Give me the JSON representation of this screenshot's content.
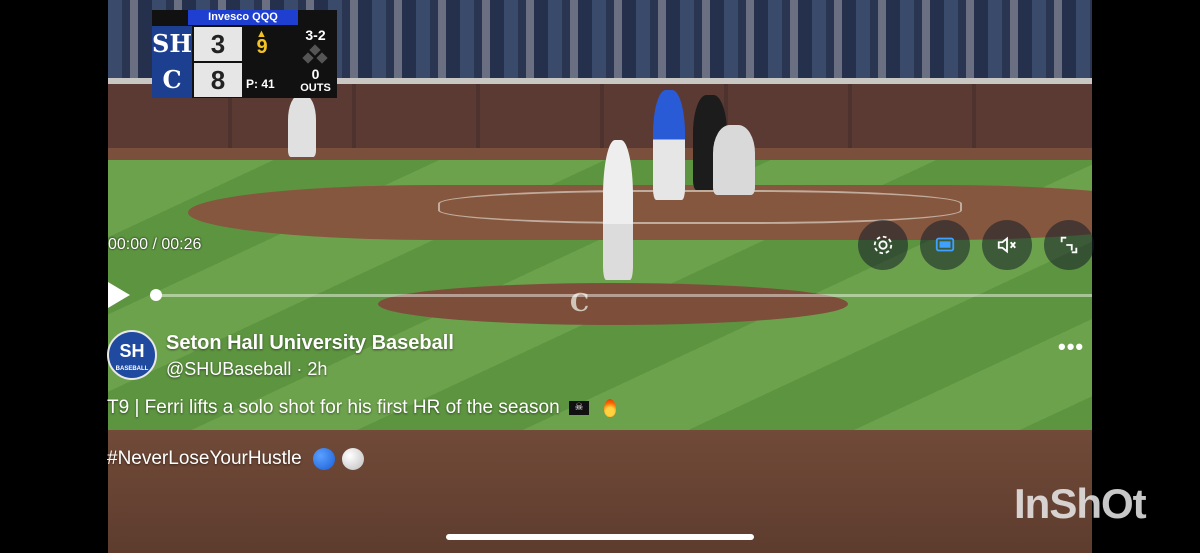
{
  "scorebug": {
    "sponsor": "Invesco QQQ",
    "team1_logo": "SH",
    "team2_logo": "C",
    "team1_score": "3",
    "team2_score": "8",
    "inning_arrow": "▲",
    "inning": "9",
    "pitch_count": "P: 41",
    "count": "3-2",
    "outs_value": "0",
    "outs_label": "OUTS"
  },
  "player": {
    "time": "00:00 / 00:26",
    "progress": 0,
    "icons": [
      "settings-icon",
      "picture-in-picture-icon",
      "mute-icon",
      "exit-fullscreen-icon",
      "play-icon"
    ]
  },
  "tweet": {
    "avatar_text": "SH",
    "avatar_sub": "BASEBALL",
    "account_name": "Seton Hall University Baseball",
    "handle": "@SHUBaseball · 2h",
    "more": "•••",
    "text": "T9 | Ferri lifts a solo shot for his first HR of the season",
    "flag_icon": "☠",
    "hashtag": "#NeverLoseYourHustle"
  },
  "watermark": "InShOt",
  "colors": {
    "brand_blue": "#1f4aa0",
    "sponsor_blue": "#1e3fd0",
    "inning_yellow": "#f4c221"
  }
}
